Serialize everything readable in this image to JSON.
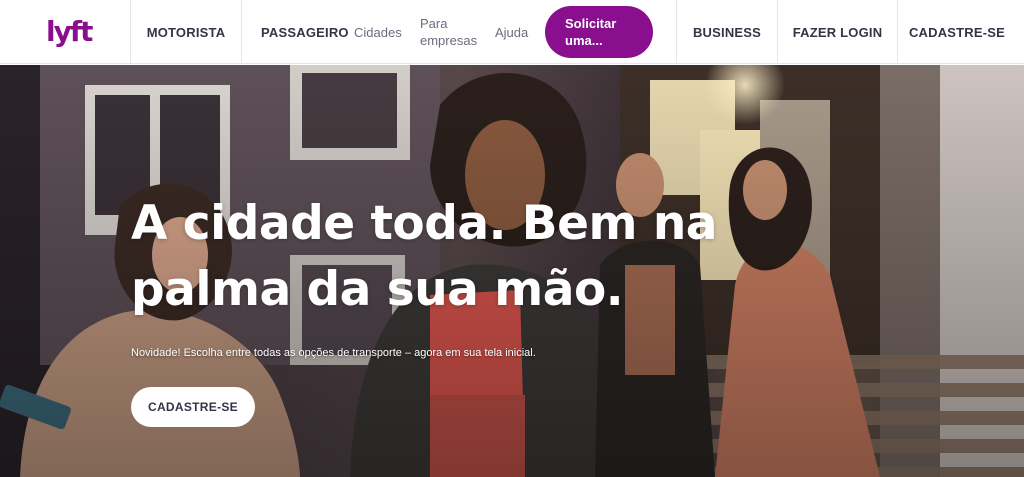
{
  "brand": {
    "logo_icon": "lyft-logo-icon",
    "color": "#8a0f8e"
  },
  "nav": {
    "motorista": "MOTORISTA",
    "passageiro": "PASSAGEIRO",
    "cidades": "Cidades",
    "empresas_line1": "Para",
    "empresas_line2": "empresas",
    "ajuda": "Ajuda",
    "solicitar_line1": "Solicitar",
    "solicitar_line2": "uma...",
    "business": "BUSINESS",
    "login": "FAZER LOGIN",
    "cadastre": "CADASTRE-SE"
  },
  "hero": {
    "title_line1": "A cidade toda. Bem na",
    "title_line2": "palma da sua mão.",
    "subtitle": "Novidade! Escolha entre todas as opções de transporte – agora em sua tela inicial.",
    "cta": "CADASTRE-SE",
    "photo_icon": "people-on-city-street-photo"
  }
}
